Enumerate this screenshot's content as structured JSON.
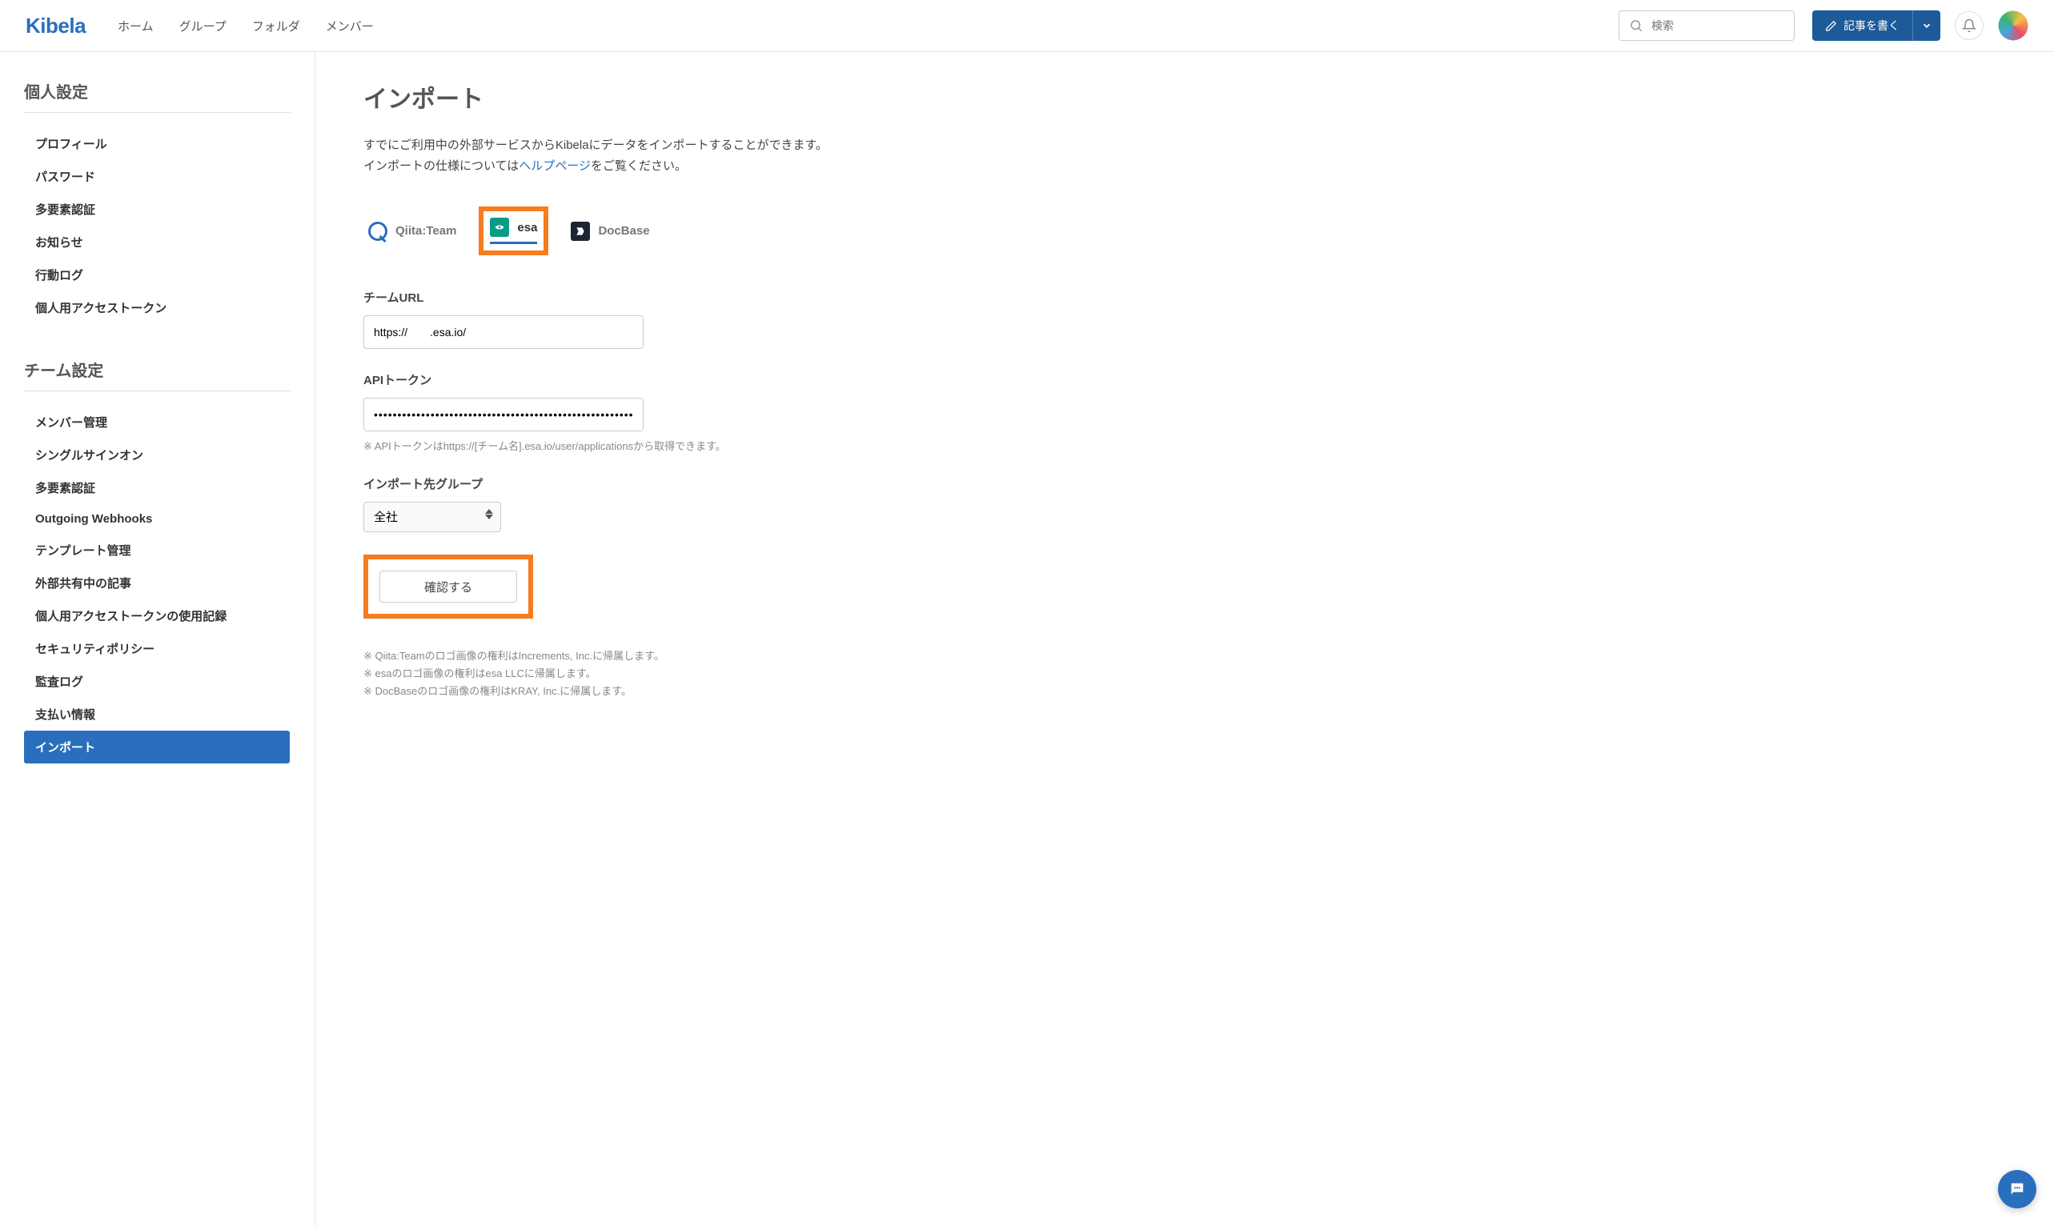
{
  "header": {
    "logo": "Kibela",
    "nav": [
      "ホーム",
      "グループ",
      "フォルダ",
      "メンバー"
    ],
    "search_placeholder": "検索",
    "write_label": "記事を書く"
  },
  "sidebar": {
    "section1_title": "個人設定",
    "section1_items": [
      "プロフィール",
      "パスワード",
      "多要素認証",
      "お知らせ",
      "行動ログ",
      "個人用アクセストークン"
    ],
    "section2_title": "チーム設定",
    "section2_items": [
      "メンバー管理",
      "シングルサインオン",
      "多要素認証",
      "Outgoing Webhooks",
      "テンプレート管理",
      "外部共有中の記事",
      "個人用アクセストークンの使用記録",
      "セキュリティポリシー",
      "監査ログ",
      "支払い情報",
      "インポート"
    ]
  },
  "main": {
    "title": "インポート",
    "intro1": "すでにご利用中の外部サービスからKibelaにデータをインポートすることができます。",
    "intro2a": "インポートの仕様については",
    "intro_link": "ヘルプページ",
    "intro2b": "をご覧ください。",
    "services": {
      "qiita": "Qiita:Team",
      "esa": "esa",
      "docbase": "DocBase"
    },
    "team_url_label": "チームURL",
    "team_url_value": "https://　　.esa.io/",
    "api_token_label": "APIトークン",
    "api_token_value": "••••••••••••••••••••••••••••••••••••••••••••••••••••••••••",
    "api_hint": "※ APIトークンはhttps://[チーム名].esa.io/user/applicationsから取得できます。",
    "group_label": "インポート先グループ",
    "group_value": "全社",
    "confirm": "確認する",
    "foot1": "※ Qiita:Teamのロゴ画像の権利はIncrements, Inc.に帰属します。",
    "foot2": "※ esaのロゴ画像の権利はesa LLCに帰属します。",
    "foot3": "※ DocBaseのロゴ画像の権利はKRAY, Inc.に帰属します。"
  }
}
